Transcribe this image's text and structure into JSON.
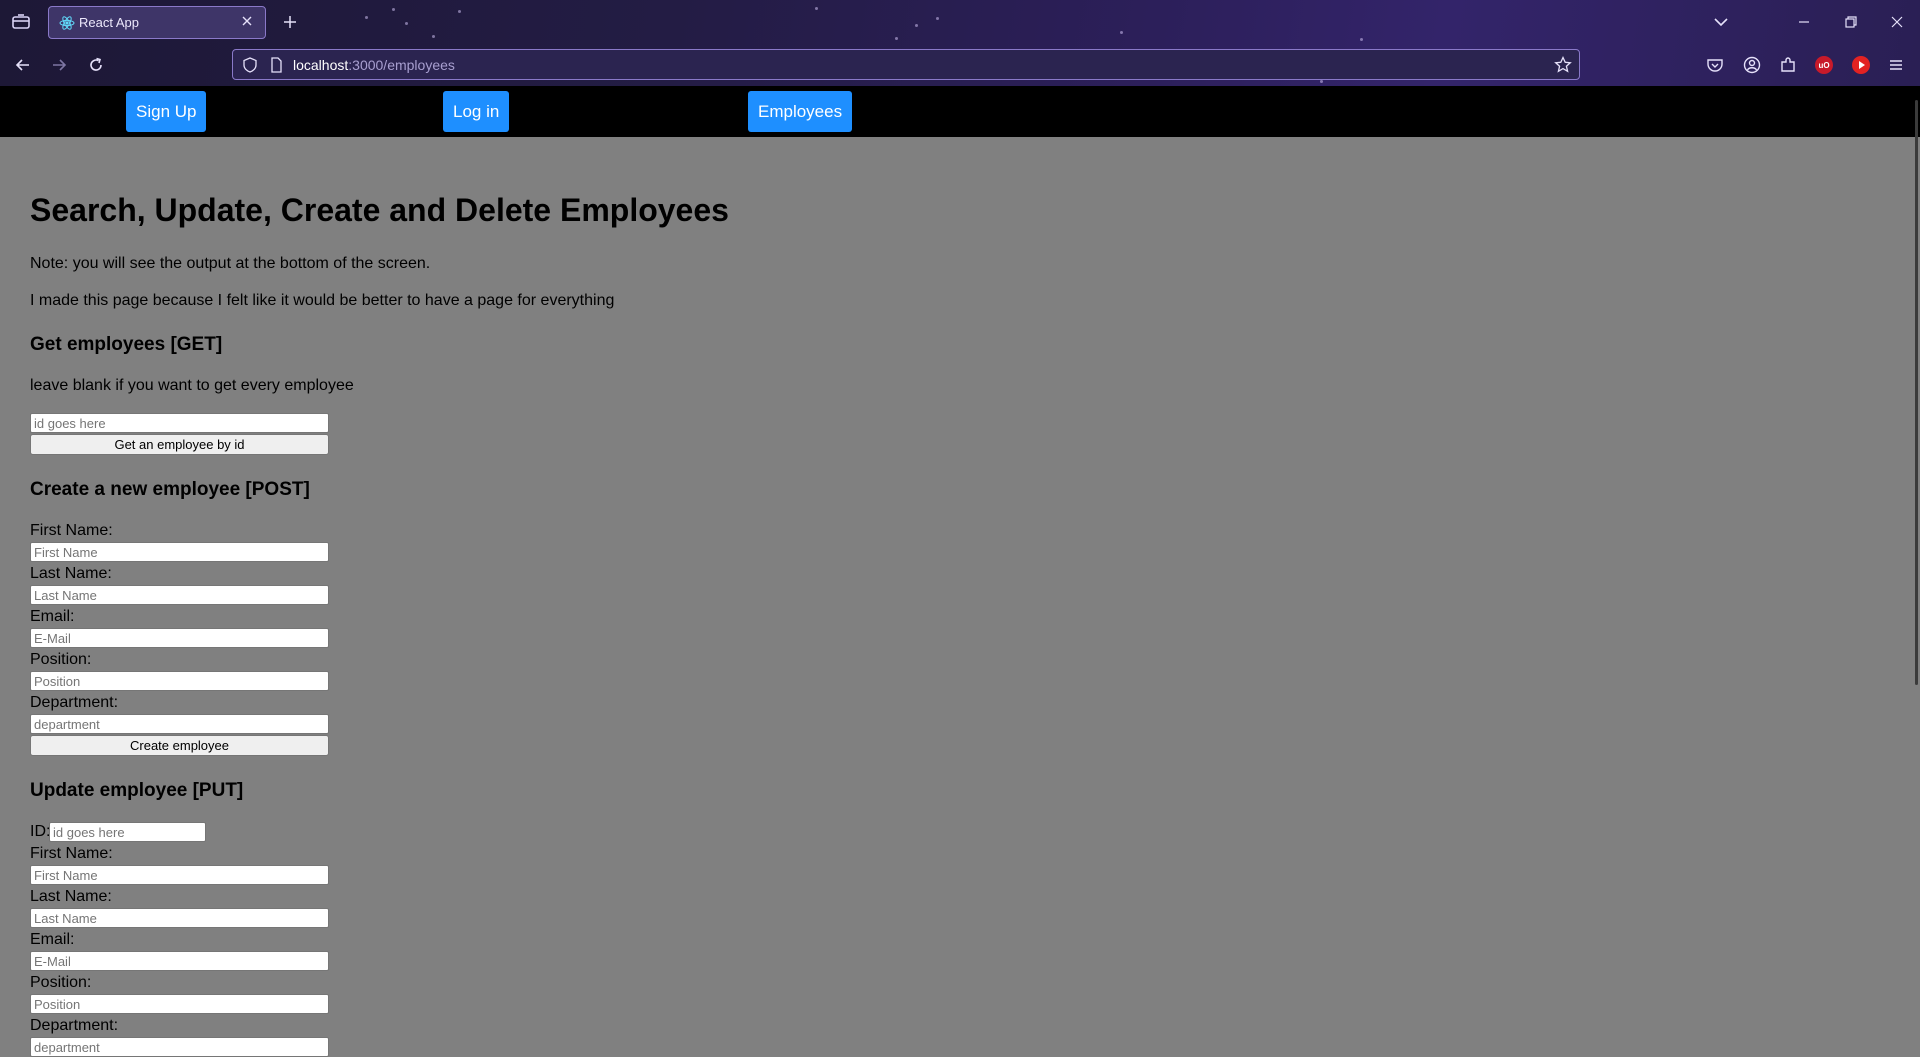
{
  "browser": {
    "tab_title": "React App",
    "url_host": "localhost",
    "url_path": ":3000/employees"
  },
  "navbar": {
    "signup": "Sign Up",
    "login": "Log in",
    "employees": "Employees"
  },
  "page": {
    "title": "Search, Update, Create and Delete Employees",
    "note": "Note: you will see the output at the bottom of the screen.",
    "reason": "I made this page because I felt like it would be better to have a page for everything",
    "get_section": {
      "heading": "Get employees [GET]",
      "hint": "leave blank if you want to get every employee",
      "id_placeholder": "id goes here",
      "button": "Get an employee by id"
    },
    "create_section": {
      "heading": "Create a new employee [POST]",
      "first_name_label": "First Name:",
      "first_name_placeholder": "First Name",
      "last_name_label": "Last Name:",
      "last_name_placeholder": "Last Name",
      "email_label": "Email:",
      "email_placeholder": "E-Mail",
      "position_label": "Position:",
      "position_placeholder": "Position",
      "department_label": "Department:",
      "department_placeholder": "department",
      "button": "Create employee"
    },
    "update_section": {
      "heading": "Update employee [PUT]",
      "id_label": "ID:",
      "id_placeholder": "id goes here",
      "first_name_label": "First Name:",
      "first_name_placeholder": "First Name",
      "last_name_label": "Last Name:",
      "last_name_placeholder": "Last Name",
      "email_label": "Email:",
      "email_placeholder": "E-Mail",
      "position_label": "Position:",
      "position_placeholder": "Position",
      "department_label": "Department:",
      "department_placeholder": "department"
    }
  },
  "colors": {
    "nav_button": "#1e8fff",
    "page_background": "#808080",
    "navbar_background": "#000000"
  }
}
